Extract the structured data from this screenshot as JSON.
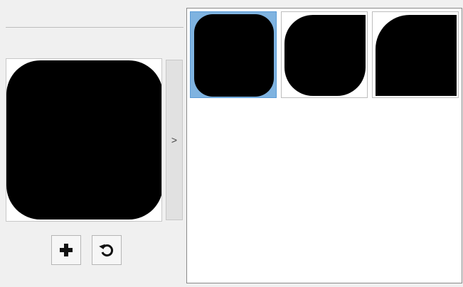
{
  "preview": {
    "shape": "rounded-rectangle"
  },
  "expand_button": {
    "label": ">"
  },
  "toolbar": {
    "add_icon": "plus-icon",
    "reset_icon": "rotate-ccw-icon"
  },
  "gallery": {
    "items": [
      {
        "shape": "rounded-rectangle",
        "selected": true
      },
      {
        "shape": "rounded-three-corners",
        "selected": false
      },
      {
        "shape": "rounded-top-left-corner",
        "selected": false
      }
    ]
  },
  "colors": {
    "selection": "#7fb3e0",
    "shape_fill": "#000000",
    "background": "#f0f0f0"
  }
}
